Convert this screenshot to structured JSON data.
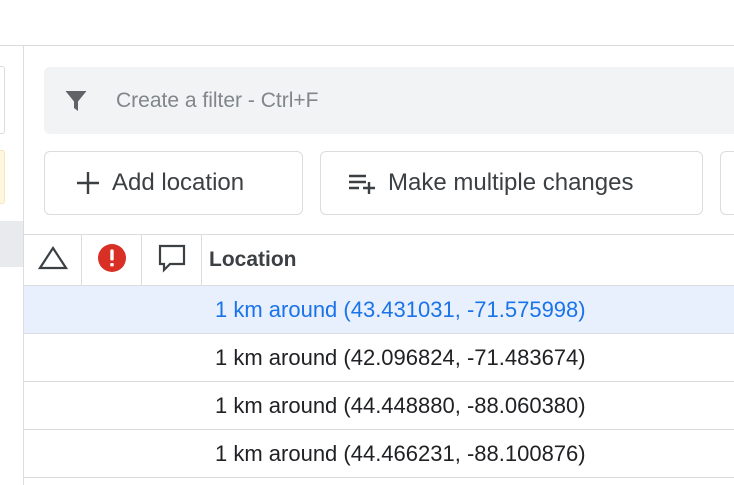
{
  "filter": {
    "placeholder": "Create a filter - Ctrl+F"
  },
  "toolbar": {
    "add_location_label": "Add location",
    "make_multiple_changes_label": "Make multiple changes"
  },
  "table": {
    "columns": {
      "location": "Location"
    },
    "rows": [
      {
        "location": "1 km around (43.431031, -71.575998)",
        "selected": true
      },
      {
        "location": "1 km around (42.096824, -71.483674)",
        "selected": false
      },
      {
        "location": "1 km around (44.448880, -88.060380)",
        "selected": false
      },
      {
        "location": "1 km around (44.466231, -88.100876)",
        "selected": false
      }
    ]
  },
  "icons": {
    "filter": "filter-icon",
    "add": "plus-icon",
    "bulk_edit": "playlist-add-icon",
    "status": "triangle-icon",
    "alert": "alert-circle-icon",
    "comment": "comment-icon"
  },
  "colors": {
    "accent": "#1a73e8",
    "alert": "#d93025",
    "selected_row": "#e8f0fe",
    "filter_bg": "#f1f3f4",
    "border": "#dadce0"
  }
}
